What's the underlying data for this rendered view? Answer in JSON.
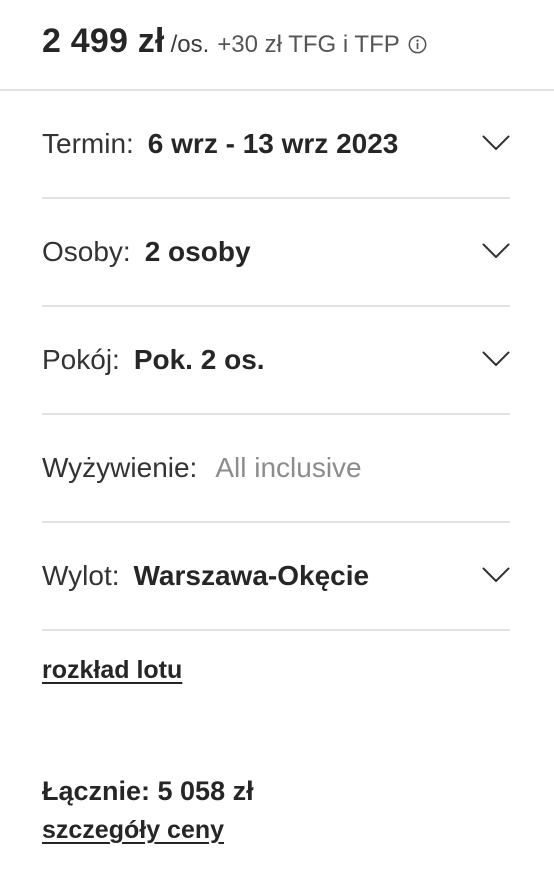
{
  "price": {
    "amount": "2 499 zł",
    "unit": "/os.",
    "extra": "+30 zł TFG i TFP",
    "info_icon": "info-circle-icon"
  },
  "rows": [
    {
      "label": "Termin:",
      "value": "6 wrz - 13 wrz 2023",
      "muted": false,
      "icon": "chevron-down-icon"
    },
    {
      "label": "Osoby:",
      "value": "2 osoby",
      "muted": false,
      "icon": "chevron-down-icon"
    },
    {
      "label": "Pokój:",
      "value": "Pok. 2 os.",
      "muted": false,
      "icon": "chevron-down-icon"
    },
    {
      "label": "Wyżywienie:",
      "value": "All inclusive",
      "muted": true,
      "icon": null
    },
    {
      "label": "Wylot:",
      "value": "Warszawa-Okęcie",
      "muted": false,
      "icon": "chevron-down-icon"
    }
  ],
  "links": {
    "flight_schedule": "rozkład lotu",
    "price_details": "szczegóły ceny"
  },
  "total": {
    "text": "Łącznie: 5 058 zł"
  },
  "colors": {
    "text": "#262626",
    "muted": "#8c8c8c",
    "divider": "#e2e2e2"
  }
}
